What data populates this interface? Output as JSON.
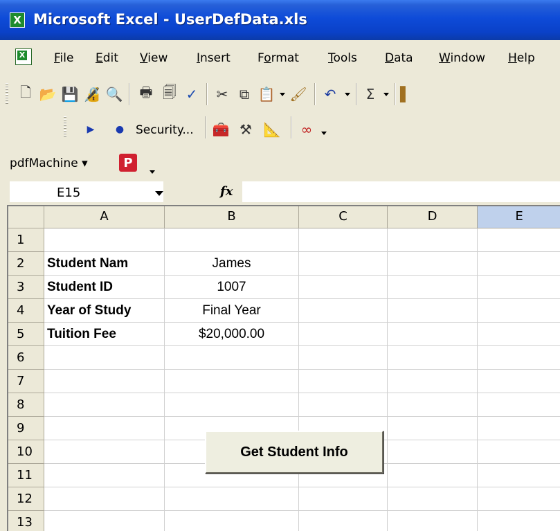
{
  "window": {
    "title": "Microsoft Excel - UserDefData.xls",
    "app_icon": "X"
  },
  "menu": {
    "items": [
      {
        "label": "File",
        "mnemonic": "F"
      },
      {
        "label": "Edit",
        "mnemonic": "E"
      },
      {
        "label": "View",
        "mnemonic": "V"
      },
      {
        "label": "Insert",
        "mnemonic": "I"
      },
      {
        "label": "Format",
        "mnemonic": "o"
      },
      {
        "label": "Tools",
        "mnemonic": "T"
      },
      {
        "label": "Data",
        "mnemonic": "D"
      },
      {
        "label": "Window",
        "mnemonic": "W"
      },
      {
        "label": "Help",
        "mnemonic": "H"
      }
    ]
  },
  "toolbar_standard": {
    "icons": [
      "new-icon",
      "open-icon",
      "save-icon",
      "permission-icon",
      "research-icon",
      "print-icon",
      "print-preview-icon",
      "spelling-icon",
      "cut-icon",
      "copy-icon",
      "paste-icon",
      "format-painter-icon",
      "undo-icon",
      "autosum-icon"
    ]
  },
  "toolbar_vb": {
    "security_label": "Security...",
    "icons": [
      "run-macro-icon",
      "record-macro-icon",
      "control-toolbox-icon",
      "design-mode-icon",
      "visual-basic-icon",
      "script-editor-icon"
    ]
  },
  "toolbar_pdf": {
    "label": "pdfMachine",
    "icon": "pdf-icon"
  },
  "formula_bar": {
    "name_box": "E15",
    "fx": "fx",
    "formula": ""
  },
  "sheet": {
    "columns": [
      "A",
      "B",
      "C",
      "D",
      "E"
    ],
    "active_column": "E",
    "rows": [
      "1",
      "2",
      "3",
      "4",
      "5",
      "6",
      "7",
      "8",
      "9",
      "10",
      "11",
      "12",
      "13"
    ],
    "cells": {
      "A2": "Student Nam",
      "A3": "Student ID",
      "A4": "Year of Study",
      "A5": "Tuition Fee",
      "B2": "James",
      "B3": "1007",
      "B4": "Final Year",
      "B5": "$20,000.00"
    },
    "button_label": "Get Student Info"
  }
}
